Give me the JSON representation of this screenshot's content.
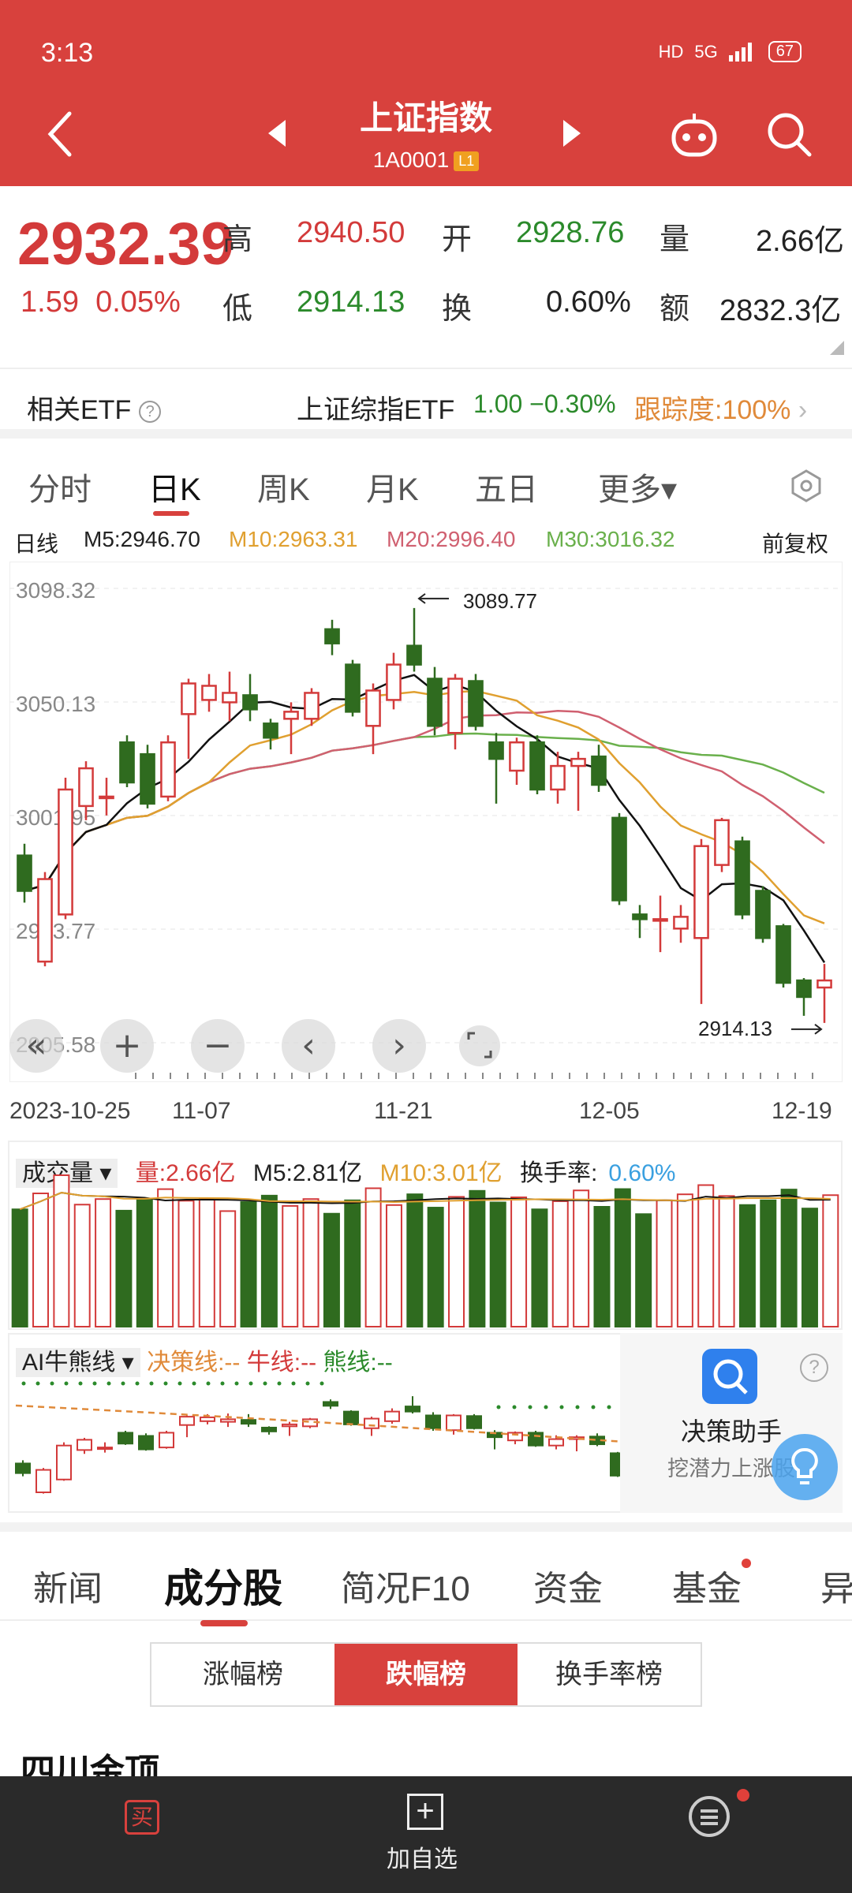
{
  "status": {
    "time": "3:13",
    "net": "5G",
    "battery": "67"
  },
  "header": {
    "title": "上证指数",
    "code": "1A0001",
    "level_badge": "L1"
  },
  "quote": {
    "price": "2932.39",
    "change": "1.59",
    "change_pct": "0.05%",
    "high_label": "高",
    "high": "2940.50",
    "open_label": "开",
    "open": "2928.76",
    "vol_label": "量",
    "volume": "2.66亿",
    "low_label": "低",
    "low": "2914.13",
    "turn_label": "换",
    "turnover": "0.60%",
    "amt_label": "额",
    "amount": "2832.3亿"
  },
  "etf": {
    "label": "相关ETF",
    "help": "?",
    "name": "上证综指ETF",
    "values": "1.00 −0.30%",
    "tracking": "跟踪度:100%"
  },
  "period_tabs": [
    "分时",
    "日K",
    "周K",
    "月K",
    "五日",
    "更多▾"
  ],
  "ma": {
    "label": "日线",
    "m5": "M5:2946.70",
    "m10": "M10:2963.31",
    "m20": "M20:2996.40",
    "m30": "M30:3016.32",
    "adjust": "前复权"
  },
  "chart_data": {
    "type": "candlestick",
    "y_ticks": [
      "3098.32",
      "3050.13",
      "3001.95",
      "2953.77",
      "2905.58"
    ],
    "ylim": [
      2905.58,
      3098.32
    ],
    "annotations": {
      "high": "3089.77",
      "low": "2914.13"
    },
    "x_ticks": [
      "2023-10-25",
      "11-07",
      "11-21",
      "12-05",
      "12-19"
    ],
    "candles": [
      {
        "o": 2985,
        "c": 2970,
        "h": 2990,
        "l": 2965
      },
      {
        "o": 2940,
        "c": 2975,
        "h": 2978,
        "l": 2938
      },
      {
        "o": 2960,
        "c": 3013,
        "h": 3018,
        "l": 2958
      },
      {
        "o": 3006,
        "c": 3022,
        "h": 3025,
        "l": 3000
      },
      {
        "o": 3010,
        "c": 3010,
        "h": 3018,
        "l": 3002
      },
      {
        "o": 3033,
        "c": 3016,
        "h": 3036,
        "l": 3014
      },
      {
        "o": 3028,
        "c": 3007,
        "h": 3032,
        "l": 3005
      },
      {
        "o": 3010,
        "c": 3033,
        "h": 3036,
        "l": 3008
      },
      {
        "o": 3045,
        "c": 3058,
        "h": 3060,
        "l": 3026
      },
      {
        "o": 3051,
        "c": 3057,
        "h": 3062,
        "l": 3046
      },
      {
        "o": 3050,
        "c": 3054,
        "h": 3063,
        "l": 3042
      },
      {
        "o": 3053,
        "c": 3047,
        "h": 3062,
        "l": 3042
      },
      {
        "o": 3041,
        "c": 3035,
        "h": 3043,
        "l": 3030
      },
      {
        "o": 3043,
        "c": 3046,
        "h": 3050,
        "l": 3028
      },
      {
        "o": 3043,
        "c": 3054,
        "h": 3056,
        "l": 3040
      },
      {
        "o": 3081,
        "c": 3075,
        "h": 3085,
        "l": 3070
      },
      {
        "o": 3066,
        "c": 3046,
        "h": 3068,
        "l": 3044
      },
      {
        "o": 3040,
        "c": 3055,
        "h": 3058,
        "l": 3028
      },
      {
        "o": 3051,
        "c": 3066,
        "h": 3071,
        "l": 3047
      },
      {
        "o": 3074,
        "c": 3066,
        "h": 3090,
        "l": 3063
      },
      {
        "o": 3060,
        "c": 3040,
        "h": 3065,
        "l": 3036
      },
      {
        "o": 3037,
        "c": 3060,
        "h": 3062,
        "l": 3030
      },
      {
        "o": 3059,
        "c": 3040,
        "h": 3062,
        "l": 3038
      },
      {
        "o": 3033,
        "c": 3026,
        "h": 3037,
        "l": 3007
      },
      {
        "o": 3021,
        "c": 3033,
        "h": 3035,
        "l": 3015
      },
      {
        "o": 3033,
        "c": 3013,
        "h": 3036,
        "l": 3011
      },
      {
        "o": 3013,
        "c": 3023,
        "h": 3029,
        "l": 3007
      },
      {
        "o": 3023,
        "c": 3026,
        "h": 3029,
        "l": 3004
      },
      {
        "o": 3027,
        "c": 3015,
        "h": 3032,
        "l": 3012
      },
      {
        "o": 3001,
        "c": 2966,
        "h": 3003,
        "l": 2964
      },
      {
        "o": 2960,
        "c": 2958,
        "h": 2964,
        "l": 2950
      },
      {
        "o": 2958,
        "c": 2958,
        "h": 2968,
        "l": 2944
      },
      {
        "o": 2954,
        "c": 2959,
        "h": 2964,
        "l": 2948
      },
      {
        "o": 2950,
        "c": 2989,
        "h": 2992,
        "l": 2922
      },
      {
        "o": 2981,
        "c": 3000,
        "h": 3001,
        "l": 2978
      },
      {
        "o": 2991,
        "c": 2960,
        "h": 2993,
        "l": 2958
      },
      {
        "o": 2970,
        "c": 2950,
        "h": 2972,
        "l": 2948
      },
      {
        "o": 2955,
        "c": 2931,
        "h": 2956,
        "l": 2929
      },
      {
        "o": 2932,
        "c": 2925,
        "h": 2933,
        "l": 2917
      },
      {
        "o": 2929,
        "c": 2932,
        "h": 2939,
        "l": 2914
      }
    ]
  },
  "controls": {
    "first": "«",
    "zoom_in": "+",
    "zoom_out": "−",
    "prev": "‹",
    "next": "›"
  },
  "volume": {
    "selector": "成交量 ▾",
    "vol": "量:2.66亿",
    "m5": "M5:2.81亿",
    "m10": "M10:3.01亿",
    "turn_label": "换手率:",
    "turn_val": "0.60%"
  },
  "ai": {
    "selector": "AI牛熊线 ▾",
    "decision": "决策线:-- ",
    "bull": "牛线:-- ",
    "bear": "熊线:--"
  },
  "assistant": {
    "title": "决策助手",
    "subtitle": "挖潜力上涨股",
    "help": "?"
  },
  "section_tabs": [
    "新闻",
    "成分股",
    "简况F10",
    "资金",
    "基金",
    "异"
  ],
  "rank_tabs": [
    "涨幅榜",
    "跌幅榜",
    "换手率榜"
  ],
  "list_first": "四川金顶",
  "bottom": {
    "buy": "买",
    "add_icon": "+",
    "add_label": "加自选"
  }
}
